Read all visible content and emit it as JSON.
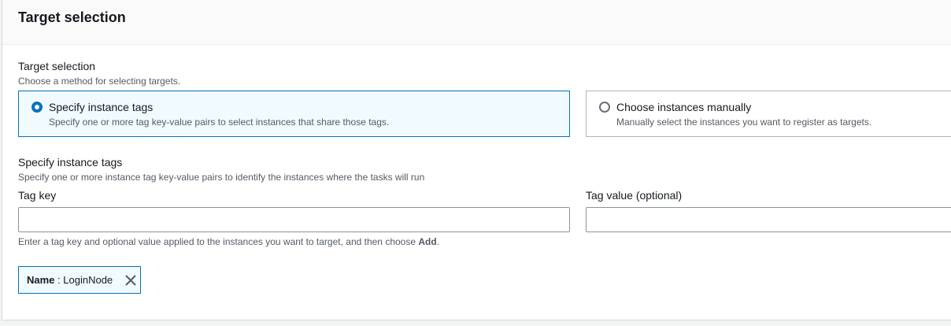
{
  "panel": {
    "title": "Target selection"
  },
  "target_selection": {
    "label": "Target selection",
    "description": "Choose a method for selecting targets.",
    "options": [
      {
        "label": "Specify instance tags",
        "description": "Specify one or more tag key-value pairs to select instances that share those tags.",
        "selected": true
      },
      {
        "label": "Choose instances manually",
        "description": "Manually select the instances you want to register as targets.",
        "selected": false
      }
    ]
  },
  "instance_tags": {
    "label": "Specify instance tags",
    "description": "Specify one or more instance tag key-value pairs to identify the instances where the tasks will run",
    "tag_key": {
      "label": "Tag key",
      "value": ""
    },
    "tag_value": {
      "label": "Tag value (optional)",
      "value": ""
    },
    "hint_prefix": "Enter a tag key and optional value applied to the instances you want to target, and then choose ",
    "hint_action": "Add",
    "hint_suffix": "."
  },
  "tokens": [
    {
      "key": "Name",
      "separator": " : ",
      "value": "LoginNode",
      "icon": "close-icon"
    }
  ],
  "colors": {
    "accent": "#0073bb",
    "selected_bg": "#f1faff",
    "border": "#aab7b8"
  }
}
